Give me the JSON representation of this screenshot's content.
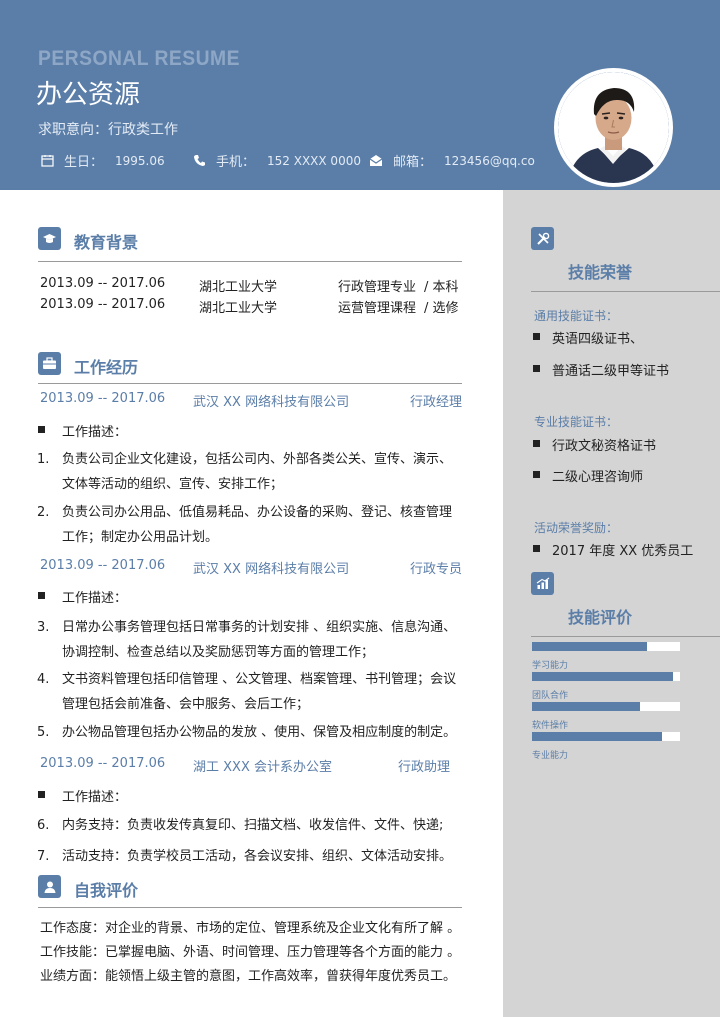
{
  "header": {
    "en_title": "PERSONAL RESUME",
    "name": "办公资源",
    "intent": "求职意向：行政类工作",
    "birthday_label": "生日：",
    "birthday": "1995.06",
    "phone_label": "手机：",
    "phone": "152 XXXX 0000",
    "email_label": "邮箱：",
    "email": "123456@qq.co"
  },
  "education": {
    "title": "教育背景",
    "rows": [
      {
        "period": "2013.09 -- 2017.06",
        "school": "湖北工业大学",
        "major": "行政管理专业",
        "degree": "/  本科"
      },
      {
        "period": "2013.09 -- 2017.06",
        "school": "湖北工业大学",
        "major": "运营管理课程",
        "degree": "/  选修"
      }
    ]
  },
  "work": {
    "title": "工作经历",
    "desc_label": "工作描述：",
    "jobs": [
      {
        "period": "2013.09 -- 2017.06",
        "company": "武汉 XX 网络科技有限公司",
        "role": "行政经理",
        "items": [
          {
            "num": "1.",
            "text": "负责公司企业文化建设，包括公司内、外部各类公关、宣传、演示、文体等活动的组织、宣传、安排工作；"
          },
          {
            "num": "2.",
            "text": "负责公司办公用品、低值易耗品、办公设备的采购、登记、核查管理工作；制定办公用品计划。"
          }
        ]
      },
      {
        "period": "2013.09 -- 2017.06",
        "company": "武汉 XX 网络科技有限公司",
        "role": "行政专员",
        "items": [
          {
            "num": "3.",
            "text": "日常办公事务管理包括日常事务的计划安排 、组织实施、信息沟通、协调控制、检查总结以及奖励惩罚等方面的管理工作；"
          },
          {
            "num": "4.",
            "text": "文书资料管理包括印信管理 、公文管理、档案管理、书刊管理；会议管理包括会前准备、会中服务、会后工作；"
          },
          {
            "num": "5.",
            "text": "办公物品管理包括办公物品的发放 、使用、保管及相应制度的制定。"
          }
        ]
      },
      {
        "period": "2013.09 -- 2017.06",
        "company": "湖工 XXX 会计系办公室",
        "role": "行政助理",
        "items": [
          {
            "num": "6.",
            "text": "内务支持：负责收发传真复印、扫描文档、收发信件、文件、快递;"
          },
          {
            "num": "7.",
            "text": "活动支持：负责学校员工活动，各会议安排、组织、文体活动安排。"
          }
        ]
      }
    ]
  },
  "self_eval": {
    "title": "自我评价",
    "lines": [
      "工作态度：对企业的背景、市场的定位、管理系统及企业文化有所了解 。",
      "工作技能：已掌握电脑、外语、时间管理、压力管理等各个方面的能力 。",
      "业绩方面：能领悟上级主管的意图，工作高效率，曾获得年度优秀员工。"
    ]
  },
  "honors": {
    "title": "技能荣誉",
    "general_label": "通用技能证书：",
    "general": [
      "英语四级证书、",
      "普通话二级甲等证书"
    ],
    "pro_label": "专业技能证书：",
    "pro": [
      "行政文秘资格证书",
      "二级心理咨询师"
    ],
    "award_label": "活动荣誉奖励：",
    "awards": [
      "2017 年度 XX 优秀员工"
    ]
  },
  "skills": {
    "title": "技能评价",
    "items": [
      {
        "label": "学习能力",
        "level": 0.78
      },
      {
        "label": "团队合作",
        "level": 0.95
      },
      {
        "label": "软件操作",
        "level": 0.73
      },
      {
        "label": "专业能力",
        "level": 0.88
      }
    ]
  },
  "colors": {
    "accent": "#5b7ea8",
    "sidebar": "#d4d4d4",
    "header": "#5b7ea8"
  }
}
